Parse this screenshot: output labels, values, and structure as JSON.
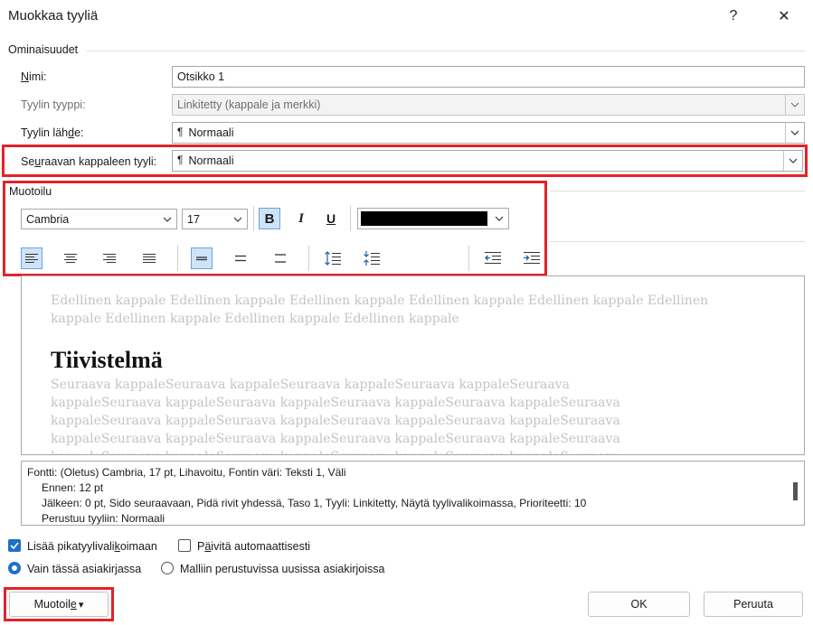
{
  "window": {
    "title": "Muokkaa tyyliä",
    "help_label": "?",
    "close_label": "✕"
  },
  "properties": {
    "section_title": "Ominaisuudet",
    "name": {
      "label_pre": "",
      "label_ul": "N",
      "label_post": "imi:",
      "value": "Otsikko 1"
    },
    "style_type": {
      "label": "Tyylin tyyppi:",
      "value": "Linkitetty (kappale ja merkki)"
    },
    "style_based_on": {
      "label_pre": "Tyylin läh",
      "label_ul": "d",
      "label_post": "e:",
      "value": "Normaali"
    },
    "next_style": {
      "label_pre": "Se",
      "label_ul": "u",
      "label_post": "raavan kappaleen tyyli:",
      "value": "Normaali"
    }
  },
  "formatting": {
    "section_title": "Muotoilu",
    "font": "Cambria",
    "size": "17",
    "bold_label": "B",
    "italic_label": "I",
    "underline_label": "U",
    "font_color": "#000000"
  },
  "preview": {
    "previous_text": "Edellinen kappale Edellinen kappale Edellinen kappale Edellinen kappale Edellinen kappale Edellinen kappale Edellinen kappale Edellinen kappale Edellinen kappale",
    "heading": "Tiivistelmä",
    "next_lines": [
      "Seuraava kappaleSeuraava kappaleSeuraava kappaleSeuraava kappaleSeuraava",
      "kappaleSeuraava kappaleSeuraava kappaleSeuraava kappaleSeuraava kappaleSeuraava",
      "kappaleSeuraava kappaleSeuraava kappaleSeuraava kappaleSeuraava kappaleSeuraava",
      "kappaleSeuraava kappaleSeuraava kappaleSeuraava kappaleSeuraava kappaleSeuraava",
      "kappaleSeuraava kappaleSeuraava kappaleSeuraava kappaleSeuraava kappaleSeuraava"
    ]
  },
  "description": {
    "line1": "Fontti: (Oletus) Cambria, 17 pt, Lihavoitu, Fontin väri: Teksti 1, Väli",
    "line2": "Ennen:  12 pt",
    "line3": "Jälkeen:  0 pt, Sido seuraavaan, Pidä rivit yhdessä, Taso 1, Tyyli: Linkitetty, Näytä tyylivalikoimassa, Prioriteetti: 10",
    "line4": "Perustuu tyyliin: Normaali"
  },
  "options": {
    "add_to_gallery": {
      "label_pre": "Lisää pikatyylivali",
      "label_ul": "k",
      "label_post": "oimaan",
      "checked": true
    },
    "auto_update": {
      "label_pre": "P",
      "label_ul": "ä",
      "label_post": "ivitä automaattisesti",
      "checked": false
    },
    "only_this_document": {
      "label_pre": "Vain tässä asiakir",
      "label_ul": "j",
      "label_post": "assa",
      "selected": true
    },
    "new_documents": {
      "label": "Malliin perustuvissa uusissa asiakirjoissa",
      "selected": false
    }
  },
  "footer": {
    "format_pre": "Muotoil",
    "format_ul": "e",
    "format_arrow": "▾",
    "ok_label": "OK",
    "cancel_label": "Peruuta"
  },
  "colors": {
    "accent": "#1f6fc6",
    "highlight": "#e3222a",
    "toggle_on": "#cfe3f8"
  }
}
